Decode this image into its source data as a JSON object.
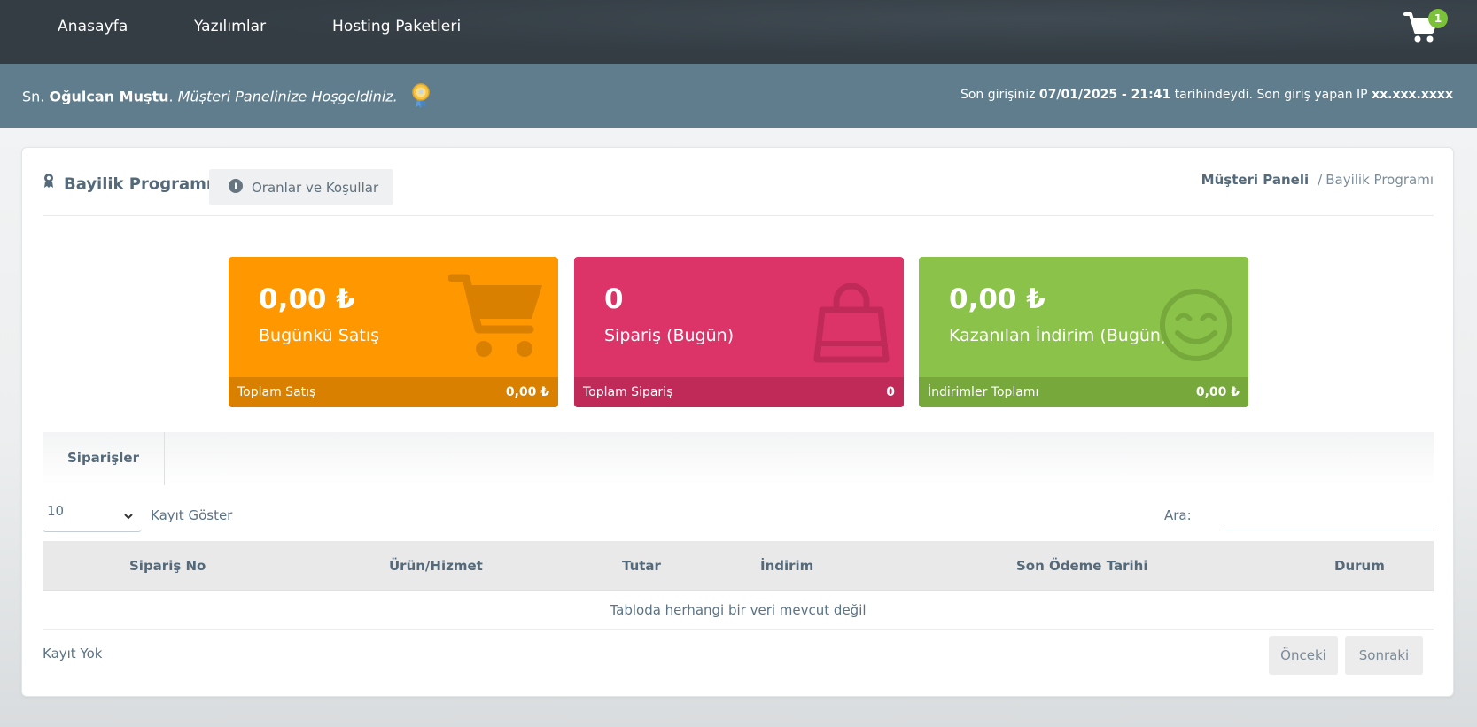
{
  "nav": {
    "links": [
      "Anasayfa",
      "Yazılımlar",
      "Hosting Paketleri"
    ],
    "cart_count": "1"
  },
  "welcome": {
    "prefix": "Sn.",
    "user_name": "Oğulcan Muştu",
    "dot": ".",
    "greeting": "Müşteri Panelinize Hoşgeldiniz.",
    "last_login_prefix": "Son girişiniz",
    "last_login_time": "07/01/2025 - 21:41",
    "last_login_mid": "tarihindeydi. Son giriş yapan IP",
    "last_login_ip": "xx.xxx.xxxx"
  },
  "header": {
    "title": "Bayilik Programı",
    "terms_button": "Oranlar ve Koşullar",
    "breadcrumb_home": "Müşteri Paneli",
    "breadcrumb_sep": "/",
    "breadcrumb_current": "Bayilik Programı"
  },
  "stats": [
    {
      "value": "0,00 ₺",
      "label": "Bugünkü Satış",
      "foot_label": "Toplam Satış",
      "foot_value": "0,00 ₺",
      "color": "#fe9700",
      "foot_color": "#d98000",
      "icon": "cart-icon"
    },
    {
      "value": "0",
      "label": "Sipariş (Bugün)",
      "foot_label": "Toplam Sipariş",
      "foot_value": "0",
      "color": "#dc3468",
      "foot_color": "#bf2a58",
      "icon": "shopping-bag-icon"
    },
    {
      "value": "0,00 ₺",
      "label": "Kazanılan İndirim (Bugün)",
      "foot_label": "İndirimler Toplamı",
      "foot_value": "0,00 ₺",
      "color": "#8bc24a",
      "foot_color": "#76a83c",
      "icon": "smiley-icon"
    }
  ],
  "tabs": {
    "active": "Siparişler"
  },
  "table": {
    "length_value": "10",
    "length_label": "Kayıt Göster",
    "search_label": "Ara:",
    "search_value": "",
    "columns": [
      "Sipariş No",
      "Ürün/Hizmet",
      "Tutar",
      "İndirim",
      "Son Ödeme Tarihi",
      "Durum"
    ],
    "empty_text": "Tabloda herhangi bir veri mevcut değil",
    "info_text": "Kayıt Yok",
    "prev_label": "Önceki",
    "next_label": "Sonraki"
  }
}
